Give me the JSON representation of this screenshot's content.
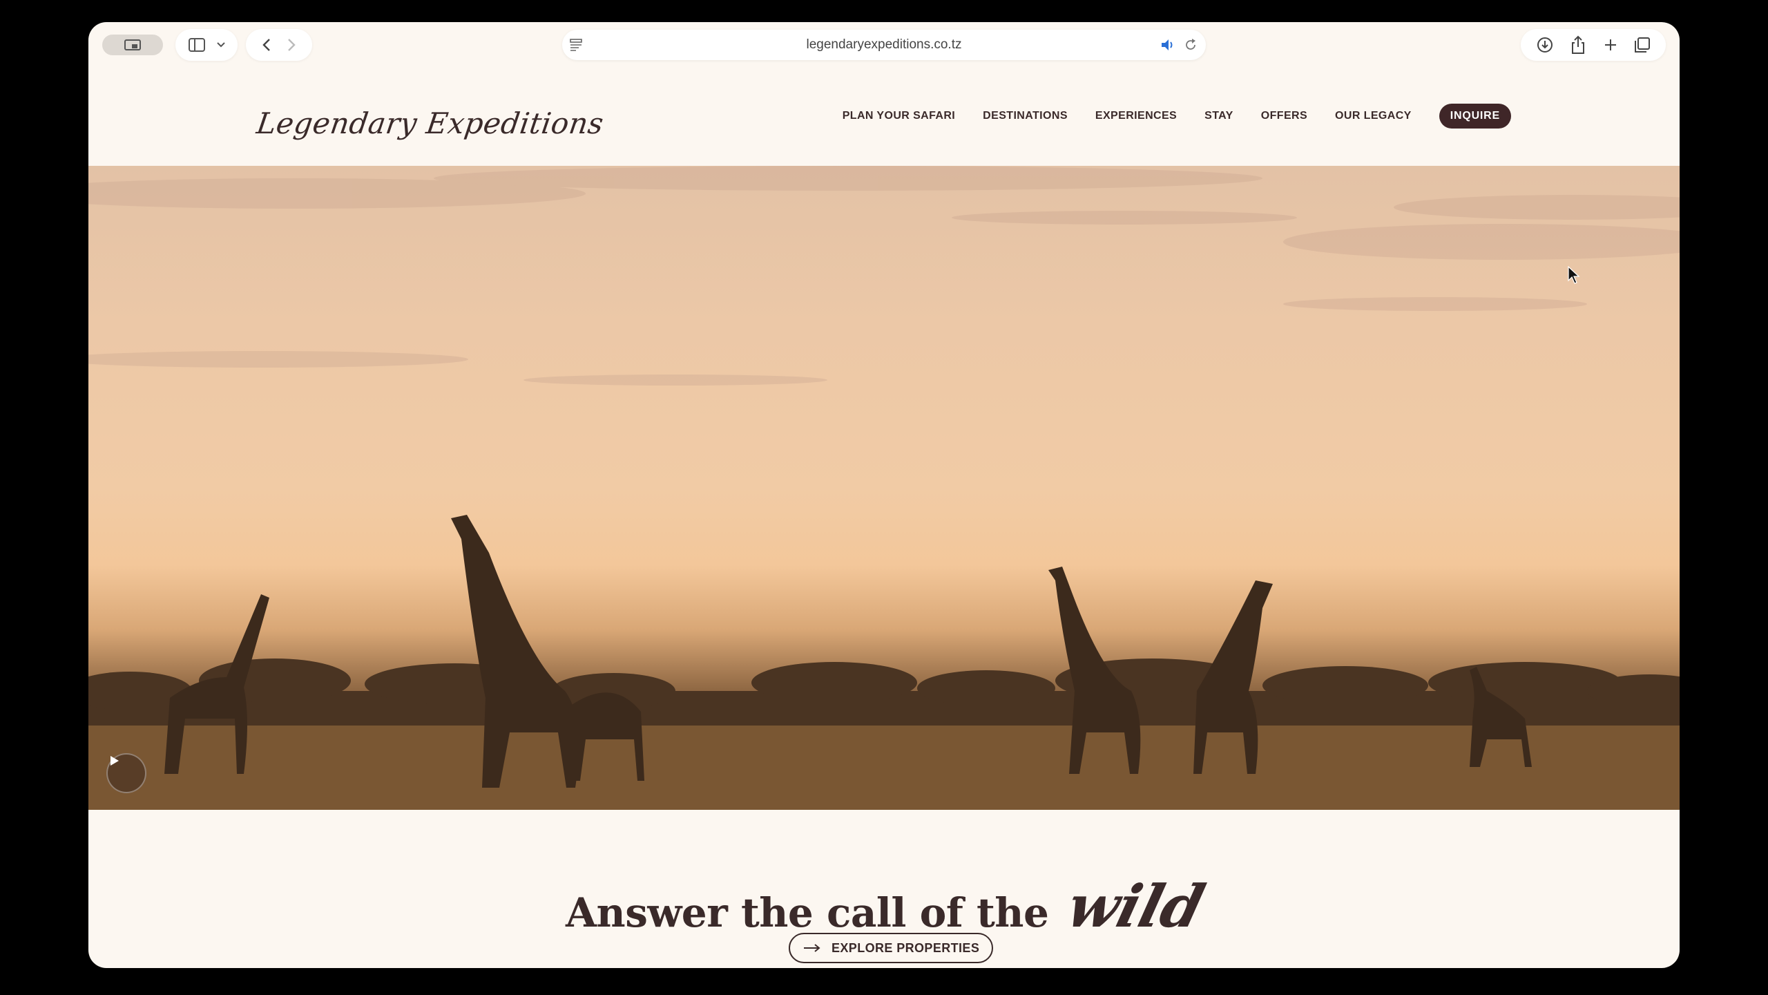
{
  "browser": {
    "url": "legendaryexpeditions.co.tz",
    "icons": [
      "tab-overview-icon",
      "sidebar-icon",
      "chevron-down-icon",
      "back-icon",
      "forward-icon",
      "reader-icon",
      "speaker-icon",
      "reload-icon",
      "download-icon",
      "share-icon",
      "new-tab-icon",
      "tabs-icon"
    ]
  },
  "site": {
    "logo": "Legendary Expeditions",
    "nav": {
      "plan": "PLAN YOUR SAFARI",
      "destinations": "DESTINATIONS",
      "experiences": "EXPERIENCES",
      "stay": "STAY",
      "offers": "OFFERS",
      "legacy": "OUR LEGACY",
      "inquire": "INQUIRE"
    },
    "hero": {
      "scene": "giraffes-at-sunset",
      "play_icon": "play-icon"
    },
    "tagline": {
      "main": "Answer the call of the",
      "script": "wild"
    },
    "explore": {
      "label": "EXPLORE PROPERTIES",
      "icon": "arrow-right-icon"
    }
  },
  "colors": {
    "page_bg": "#fcf7f1",
    "brand_dark": "#3f2628",
    "text": "#3a2a2a"
  }
}
